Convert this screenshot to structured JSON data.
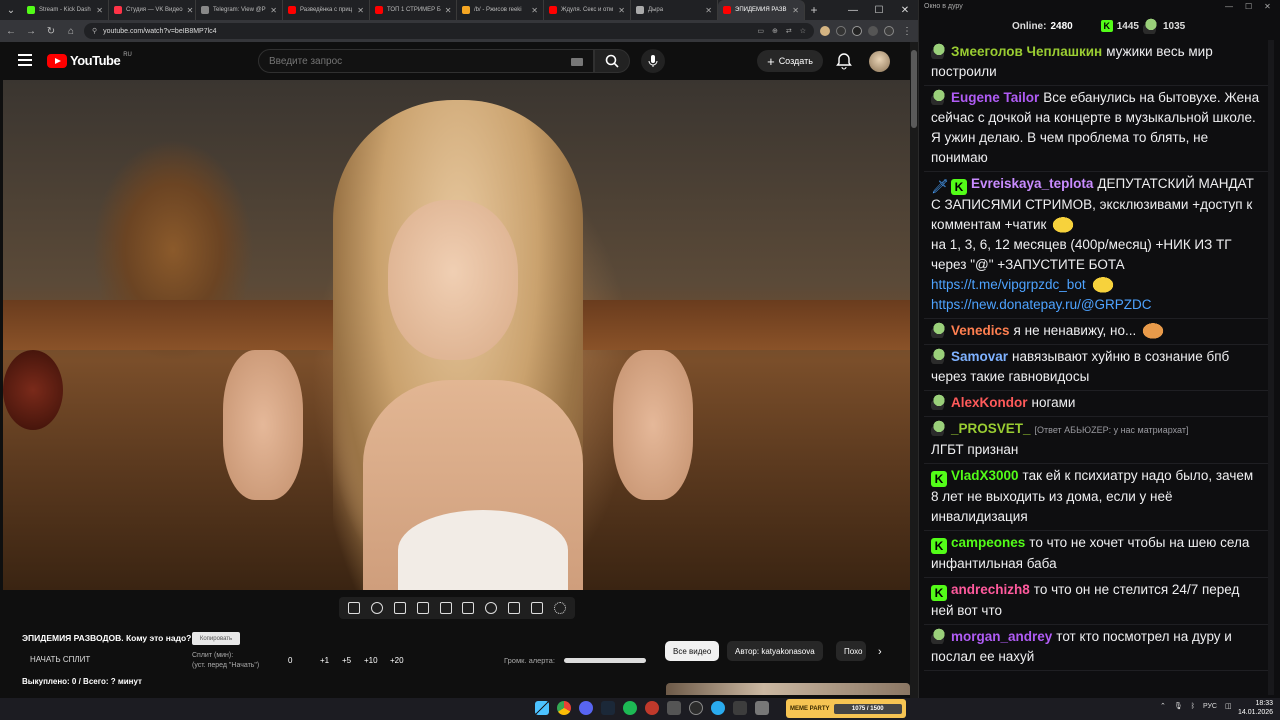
{
  "browser": {
    "tabs": [
      {
        "label": "Stream - Kick Dash",
        "color": "#53fc18"
      },
      {
        "label": "Студия — VK Видео",
        "color": "#ff3347"
      },
      {
        "label": "Telegram: View @P",
        "color": "#888888"
      },
      {
        "label": "Разведёнка с приц",
        "color": "#ff0000"
      },
      {
        "label": "ТОП 1 СТРИМЕР Б",
        "color": "#ff0000"
      },
      {
        "label": "/b/ - Ржисов reeki",
        "color": "#f5a623"
      },
      {
        "label": "Ждуля. Секс и отм",
        "color": "#ff0000"
      },
      {
        "label": "Дыра",
        "color": "#aaaaaa"
      },
      {
        "label": "ЭПИДЕМИЯ РАЗВ",
        "color": "#ff0000",
        "active": true
      }
    ],
    "url": "youtube.com/watch?v=beIB8MP7lc4"
  },
  "youtube": {
    "logo_text": "YouTube",
    "region": "RU",
    "search_placeholder": "Введите запрос",
    "create_label": "Создать",
    "video_title": "ЭПИДЕМИЯ РАЗВОДОВ. Кому это надо?",
    "copy_label": "Копировать",
    "start_split": "НАЧАТЬ СПЛИТ",
    "split_label": "Сплит (мин):",
    "split_hint": "(уст. перед \"Начать\")",
    "split_value": "0",
    "add_buttons": [
      "+1",
      "+5",
      "+10",
      "+20"
    ],
    "bought": "Выкуплено: 0 / Всего: ? минут",
    "alert_volume_label": "Громк. алерта:",
    "alert_volume_level": 1.0,
    "chips": [
      "Все видео",
      "Автор: katyakonasova",
      "Похо"
    ]
  },
  "chat": {
    "window_title": "Окно в дуру",
    "online_label": "Online:",
    "online_value": "2480",
    "kick_count": "1445",
    "other_count": "1035",
    "messages": [
      {
        "user": "Змееголов Чеплашкин",
        "color": "#9acd32",
        "badges": [
          "pepe"
        ],
        "text": "мужики весь мир построили"
      },
      {
        "user": "Eugene Tailor",
        "color": "#b05cf5",
        "badges": [
          "pepe"
        ],
        "text": "Все ебанулись на бытовухе. Жена сейчас с дочкой на концерте в музыкальной школе. Я ужин делаю. В чем проблема то блять, не понимаю"
      },
      {
        "user": "Evreiskaya_teplota",
        "color": "#c98cff",
        "badges": [
          "sword",
          "kick"
        ],
        "text": "ДЕПУТАТСКИЙ МАНДАТ С ЗАПИСЯМИ СТРИМОВ, эксклюзивами +доступ к комментам +чатик",
        "text2": "на 1, 3, 6, 12 месяцев (400р/месяц) +НИК ИЗ ТГ через \"@\" +ЗАПУСТИТЕ БОТА",
        "link1": "https://t.me/vipgrpzdc_bot",
        "link2": "https://new.donatepay.ru/@GRPZDC"
      },
      {
        "user": "Venedics",
        "color": "#ff7f50",
        "badges": [
          "pepe"
        ],
        "text": "я не  ненавижу, но..."
      },
      {
        "user": "Samovar",
        "color": "#7fb2ff",
        "badges": [
          "pepe"
        ],
        "text": "навязывают хуйню в сознание бпб через такие гавновидосы"
      },
      {
        "user": "AlexKondor",
        "color": "#ff5a5a",
        "badges": [
          "pepe"
        ],
        "text": "ногами"
      },
      {
        "user": "_PROSVET_",
        "color": "#9acd32",
        "badges": [
          "pepe"
        ],
        "reply": "[Ответ АБЬЮZEP: у нас матриархат]",
        "text": "ЛГБТ признан"
      },
      {
        "user": "VladX3000",
        "color": "#53fc18",
        "badges": [
          "kick"
        ],
        "text": "так ей к психиатру надо было, зачем 8 лет не выходить из дома, если у неё инвалидизация"
      },
      {
        "user": "campeones",
        "color": "#53fc18",
        "badges": [
          "kick"
        ],
        "text": "то что не хочет чтобы на шею села инфантильная баба"
      },
      {
        "user": "andrechizh8",
        "color": "#ff5a9d",
        "badges": [
          "kick"
        ],
        "text": "то что он не стелится 24/7 перед ней вот что"
      },
      {
        "user": "morgan_andrey",
        "color": "#b05cf5",
        "badges": [
          "pepe"
        ],
        "text": "тот кто посмотрел на дуру и послал ее нахуй"
      }
    ]
  },
  "taskbar": {
    "widget_text": "MEME PARTY",
    "widget_progress": "1075 / 1500",
    "lang": "РУС",
    "time": "18:33",
    "date": "14.01.2026"
  }
}
